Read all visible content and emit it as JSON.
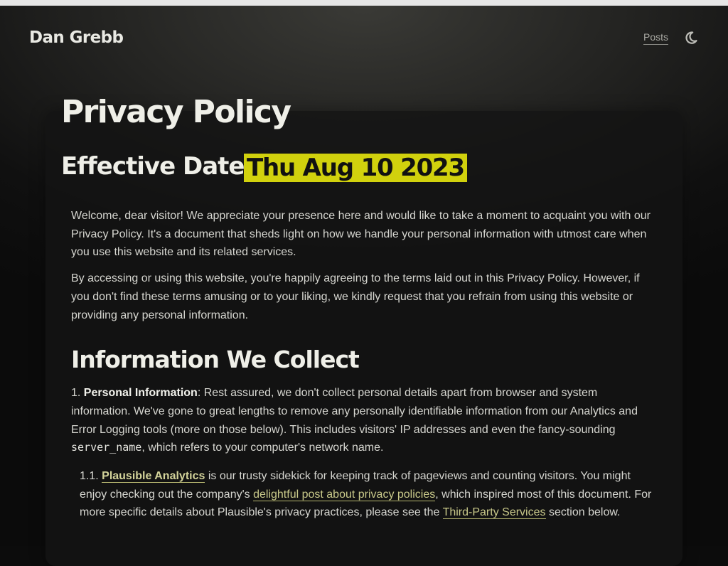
{
  "header": {
    "site_title": "Dan Grebb",
    "nav": {
      "posts_label": "Posts"
    },
    "theme_toggle_icon": "moon-icon"
  },
  "page": {
    "title": "Privacy Policy",
    "effective_label": "Effective Date:",
    "effective_date": "Thu Aug 10 2023",
    "highlight_color": "#d1d10d"
  },
  "intro": {
    "p1": "Welcome, dear visitor! We appreciate your presence here and would like to take a moment to acquaint you with our Privacy Policy. It's a document that sheds light on how we handle your personal information with utmost care when you use this website and its related services.",
    "p2": "By accessing or using this website, you're happily agreeing to the terms laid out in this Privacy Policy. However, if you don't find these terms amusing or to your liking, we kindly request that you refrain from using this website or providing any personal information."
  },
  "section1": {
    "heading": "Information We Collect",
    "item1": {
      "number": "1.",
      "term": "Personal Information",
      "text_a": ": Rest assured, we don't collect personal details apart from browser and system information. We've gone to great lengths to remove any personally identifiable information from our Analytics and Error Logging tools (more on those below). This includes visitors' IP addresses and even the fancy-sounding ",
      "code": "server_name",
      "text_b": ", which refers to your computer's network name."
    },
    "item1_1": {
      "number": "1.1.",
      "link_analytics": "Plausible Analytics",
      "text_a": " is our trusty sidekick for keeping track of pageviews and counting visitors. You might enjoy checking out the company's ",
      "link_post": "delightful post about privacy policies",
      "text_b": ", which inspired most of this document. For more specific details about Plausible's privacy practices, please see the ",
      "link_third_party": "Third-Party Services",
      "text_c": " section below."
    }
  }
}
